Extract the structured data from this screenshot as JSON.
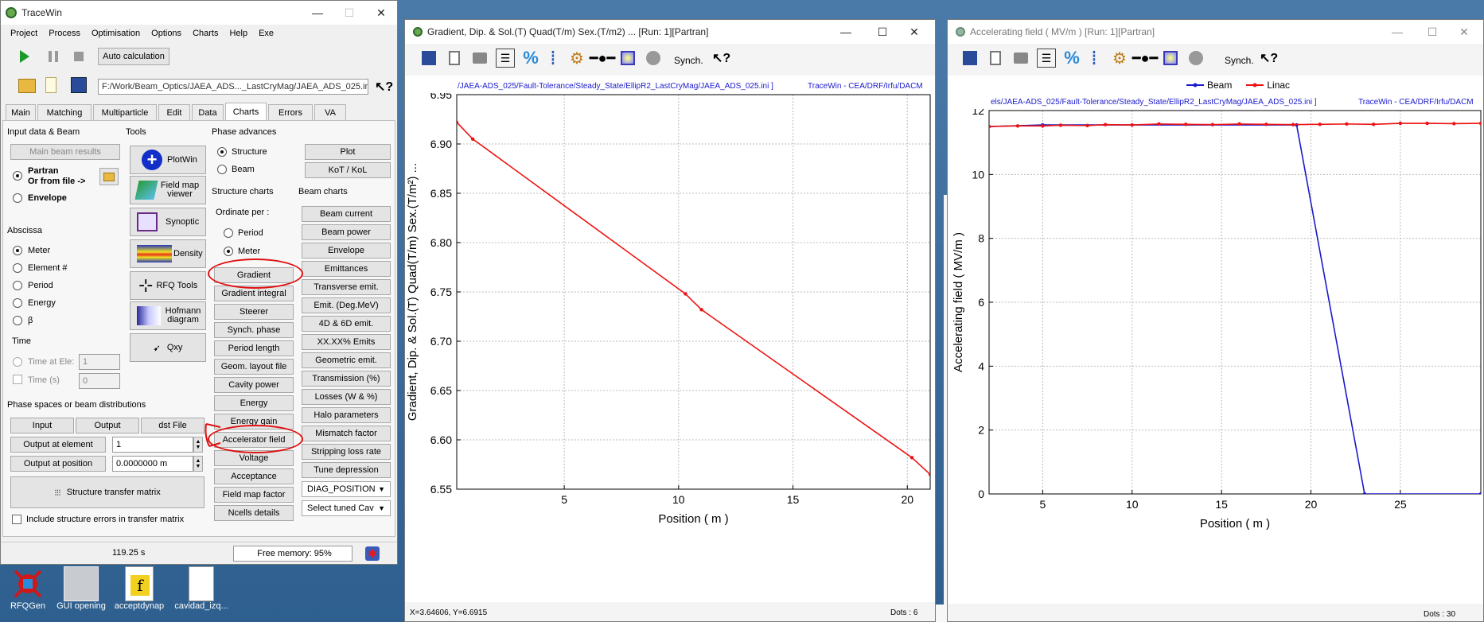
{
  "tracewin": {
    "title": "TraceWin",
    "menu": [
      "Project",
      "Process",
      "Optimisation",
      "Options",
      "Charts",
      "Help",
      "Exe"
    ],
    "auto_calc": "Auto calculation",
    "project_path": "F:/Work/Beam_Optics/JAEA_ADS..._LastCryMag/JAEA_ADS_025.ini",
    "tabs": [
      "Main",
      "Matching",
      "Multiparticle",
      "Edit",
      "Data",
      "Charts",
      "Errors",
      "VA"
    ],
    "active_tab": "Charts",
    "input_data_beam": "Input data & Beam",
    "main_beam_results": "Main beam results",
    "partran": "Partran",
    "or_from_file": "Or from file ->",
    "envelope": "Envelope",
    "abscissa": "Abscissa",
    "abscissa_options": [
      "Meter",
      "Element #",
      "Period",
      "Energy",
      "β"
    ],
    "time": "Time",
    "time_at_ele": "Time at Ele:",
    "time_at_ele_val": "1",
    "time_s": "Time (s)",
    "time_s_val": "0",
    "tools": "Tools",
    "tool_buttons": [
      "PlotWin",
      "Field map viewer",
      "Synoptic",
      "Density",
      "RFQ Tools",
      "Hofmann diagram",
      "Qxy"
    ],
    "phase_advances": "Phase advances",
    "structure": "Structure",
    "beam": "Beam",
    "plot": "Plot",
    "kot_kol": "KoT / KoL",
    "structure_charts": "Structure charts",
    "beam_charts": "Beam charts",
    "ordinate_per": "Ordinate per :",
    "period": "Period",
    "meter": "Meter",
    "structure_chart_buttons": [
      "Gradient",
      "Gradient integral",
      "Steerer",
      "Synch. phase",
      "Period length",
      "Geom. layout file",
      "Cavity power",
      "Energy",
      "Energy gain",
      "Accelerator field",
      "Voltage",
      "Acceptance",
      "Field map factor",
      "Ncells details"
    ],
    "beam_chart_buttons": [
      "Beam current",
      "Beam power",
      "Envelope",
      "Emittances",
      "Transverse emit.",
      "Emit. (Deg.MeV)",
      "4D & 6D emit.",
      "XX.XX% Emits",
      "Geometric emit.",
      "Transmission (%)",
      "Losses (W & %)",
      "Halo parameters",
      "Mismatch factor",
      "Stripping loss rate",
      "Tune depression"
    ],
    "diag_position": "DIAG_POSITION",
    "select_tuned_cav": "Select tuned Cav",
    "phase_spaces": "Phase spaces or beam distributions",
    "input_btn": "Input",
    "output_btn": "Output",
    "dst_file": "dst File",
    "output_at_element": "Output at element",
    "output_at_element_val": "1",
    "output_at_position": "Output at position",
    "output_at_position_val": "0.0000000 m",
    "structure_transfer_matrix": "Structure transfer matrix",
    "include_errors": "Include structure errors in transfer matrix",
    "status_time": "119.25 s",
    "free_memory": "Free memory: 95%"
  },
  "desktop_icons": [
    "RFQGen",
    "GUI opening",
    "acceptdynap",
    "cavidad_izq..."
  ],
  "gradient_window": {
    "title": "Gradient, Dip. & Sol.(T) Quad(T/m) Sex.(T/m2) ... [Run: 1][Partran]",
    "synch": "Synch.",
    "header_path": "/JAEA-ADS_025/Fault-Tolerance/Steady_State/EllipR2_LastCryMag/JAEA_ADS_025.ini ]",
    "header_credit": "TraceWin - CEA/DRF/Irfu/DACM",
    "status_coords": "X=3.64606, Y=6.6915",
    "status_dots": "Dots : 6"
  },
  "accel_window": {
    "title": "Accelerating field ( MV/m ) [Run: 1][Partran]",
    "synch": "Synch.",
    "header_path": "els/JAEA-ADS_025/Fault-Tolerance/Steady_State/EllipR2_LastCryMag/JAEA_ADS_025.ini ]",
    "header_credit": "TraceWin - CEA/DRF/Irfu/DACM",
    "status_dots": "Dots : 30"
  },
  "chart_data": [
    {
      "type": "line",
      "xlabel": "Position ( m )",
      "ylabel": "Gradient, Dip. & Sol.(T) Quad(T/m) Sex.(T/m²) ...",
      "xlim": [
        0.3,
        21.0
      ],
      "ylim": [
        6.55,
        6.95
      ],
      "xticks": [
        5,
        10,
        15,
        20
      ],
      "yticks": [
        6.55,
        6.6,
        6.65,
        6.7,
        6.75,
        6.8,
        6.85,
        6.9,
        6.95
      ],
      "grid": true,
      "series": [
        {
          "color": "#ee1111",
          "x": [
            0.3,
            1.0,
            10.3,
            11.0,
            20.2,
            21.0
          ],
          "y": [
            6.922,
            6.905,
            6.748,
            6.732,
            6.582,
            6.565
          ]
        }
      ]
    },
    {
      "type": "line",
      "xlabel": "Position ( m )",
      "ylabel": "Accelerating field ( MV/m )",
      "xlim": [
        2.0,
        29.5
      ],
      "ylim": [
        0,
        12
      ],
      "xticks": [
        5,
        10,
        15,
        20,
        25
      ],
      "yticks": [
        0,
        2,
        4,
        6,
        8,
        10,
        12
      ],
      "grid": true,
      "legend": "top-center",
      "series": [
        {
          "name": "Beam",
          "color": "#1a1acc",
          "x": [
            2.0,
            5.0,
            19.2,
            23.0,
            29.5
          ],
          "y": [
            11.5,
            11.55,
            11.55,
            0.0,
            0.0
          ]
        },
        {
          "name": "Linac",
          "color": "#ee1111",
          "x": [
            2.0,
            3.6,
            5.0,
            6.0,
            7.5,
            8.5,
            10.0,
            11.5,
            13.0,
            14.5,
            16.0,
            17.5,
            19.0,
            20.5,
            22.0,
            23.5,
            25.0,
            26.5,
            28.0,
            29.5
          ],
          "y": [
            11.5,
            11.52,
            11.52,
            11.54,
            11.53,
            11.56,
            11.55,
            11.58,
            11.57,
            11.56,
            11.58,
            11.57,
            11.56,
            11.57,
            11.58,
            11.57,
            11.6,
            11.6,
            11.59,
            11.6
          ]
        }
      ]
    }
  ]
}
